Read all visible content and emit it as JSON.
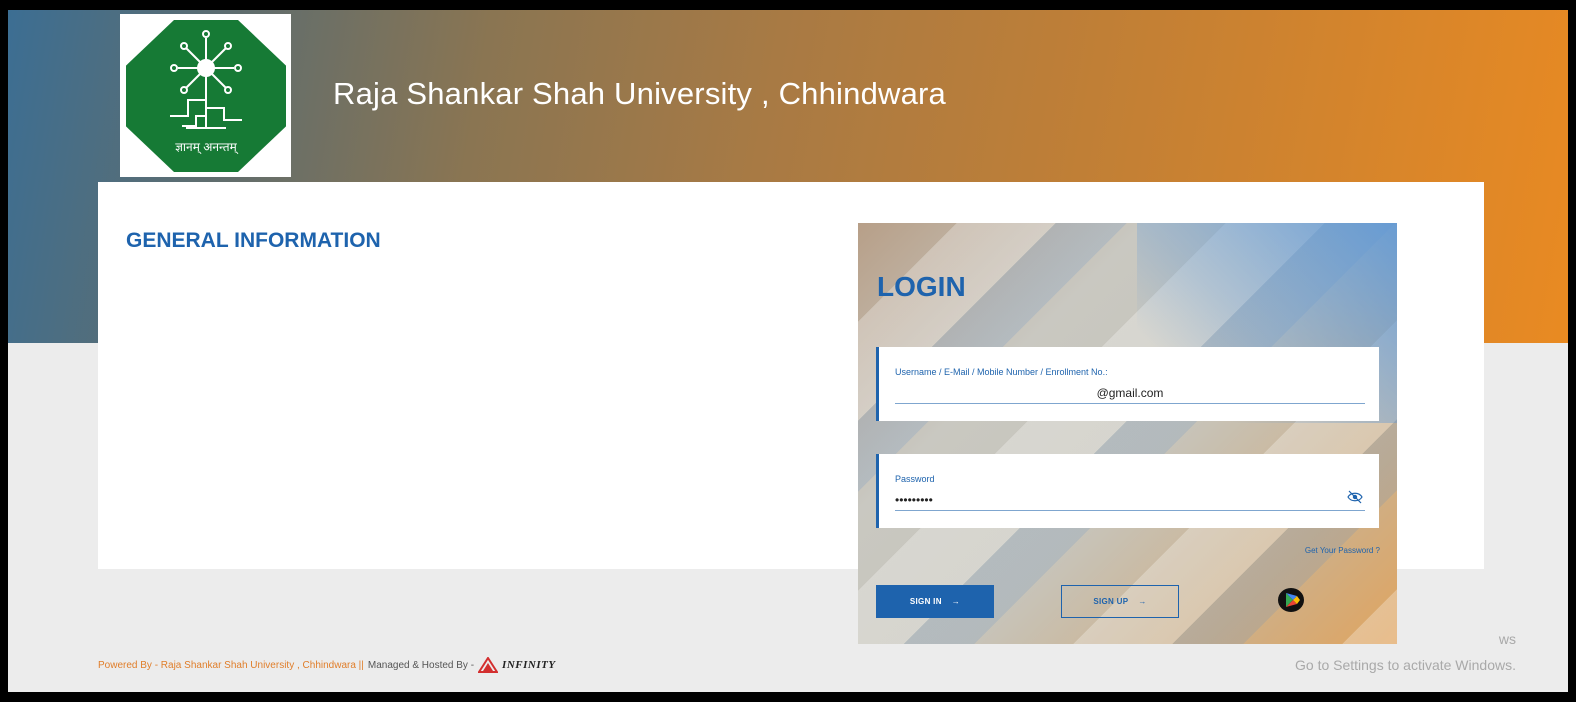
{
  "header": {
    "university_title": "Raja Shankar Shah University , Chhindwara",
    "logo_motto": "ज्ञानम् अनन्तम्"
  },
  "general_info": {
    "heading": "GENERAL INFORMATION"
  },
  "login": {
    "title": "LOGIN",
    "username_label": "Username / E-Mail / Mobile Number / Enrollment No.:",
    "username_value": "@gmail.com",
    "password_label": "Password",
    "password_value": "•••••••••",
    "forgot_link": "Get Your Password ?",
    "signin_label": "SIGN IN",
    "signup_label": "SIGN UP",
    "arrow": "→"
  },
  "footer": {
    "powered_by": "Powered By - Raja Shankar Shah University , Chhindwara ||",
    "managed_by": "Managed & Hosted By -",
    "infinity": "INFINITY"
  },
  "windows_watermark": {
    "line1": "ws",
    "line2": "Go to Settings to activate Windows."
  },
  "colors": {
    "brand_blue": "#1e63ad",
    "logo_green": "#167a35",
    "banner_orange": "#e98a22"
  }
}
